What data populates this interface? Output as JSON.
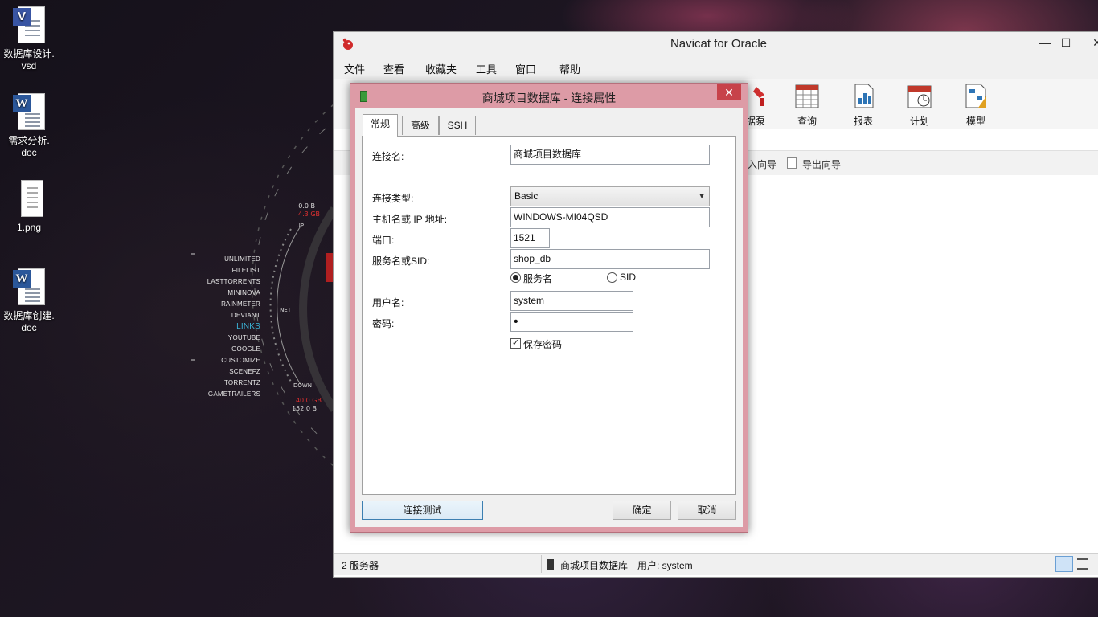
{
  "desktop": {
    "icons": [
      {
        "label": "数据库设计.\nvsd",
        "line1": "数据库设计.",
        "line2": "vsd",
        "type": "visio-icon"
      },
      {
        "label": "需求分析.doc",
        "line1": "需求分析.",
        "line2": "doc",
        "type": "word-doc-icon"
      },
      {
        "label": "1.png",
        "line1": "1.png",
        "line2": "",
        "type": "image-file-icon"
      },
      {
        "label": "数据库创建.doc",
        "line1": "数据库创建.",
        "line2": "doc",
        "type": "word-doc-icon"
      }
    ],
    "hud": {
      "links": [
        "UNLIMITED",
        "FILELIST",
        "LASTTORRENTS",
        "MININOVA",
        "RAINMETER",
        "DEVIANT",
        "LINKS",
        "YOUTUBE",
        "GOOGLE",
        "CUSTOMIZE",
        "SCENEFZ",
        "TORRENTZ",
        "GAMETRAILERS"
      ],
      "up_label": "UP",
      "net_label": "NET",
      "down_label": "DOWN",
      "up_value": "0.0 B",
      "up_total": "4.3 GB",
      "down_total": "40.0 GB",
      "down_value": "152.0 B"
    }
  },
  "navicat": {
    "title": "Navicat for Oracle",
    "menu": [
      "文件",
      "查看",
      "收藏夹",
      "工具",
      "窗口",
      "帮助"
    ],
    "toolbar": [
      {
        "label": "据泵",
        "icon": "data-pump-icon"
      },
      {
        "label": "查询",
        "icon": "query-icon"
      },
      {
        "label": "报表",
        "icon": "report-icon"
      },
      {
        "label": "计划",
        "icon": "schedule-icon"
      },
      {
        "label": "模型",
        "icon": "model-icon"
      }
    ],
    "subbar": {
      "import": "入向导",
      "export": "导出向导"
    },
    "status": {
      "servers": "2 服务器",
      "connection": "商城项目数据库",
      "user": "用户: system"
    }
  },
  "dialog": {
    "title": "商城项目数据库 - 连接属性",
    "close": "✕",
    "tabs": [
      "常规",
      "高级",
      "SSH"
    ],
    "active_tab": "常规",
    "fields": {
      "connection_name_label": "连接名:",
      "connection_name_value": "商城项目数据库",
      "connection_type_label": "连接类型:",
      "connection_type_value": "Basic",
      "host_label": "主机名或 IP 地址:",
      "host_value": "WINDOWS-MI04QSD",
      "port_label": "端口:",
      "port_value": "1521",
      "service_label": "服务名或SID:",
      "service_value": "shop_db",
      "radio_service": "服务名",
      "radio_sid": "SID",
      "radio_selected": "服务名",
      "username_label": "用户名:",
      "username_value": "system",
      "password_label": "密码:",
      "password_value": "•",
      "save_password_label": "保存密码",
      "save_password_checked": true
    },
    "buttons": {
      "test": "连接测试",
      "ok": "确定",
      "cancel": "取消"
    }
  }
}
